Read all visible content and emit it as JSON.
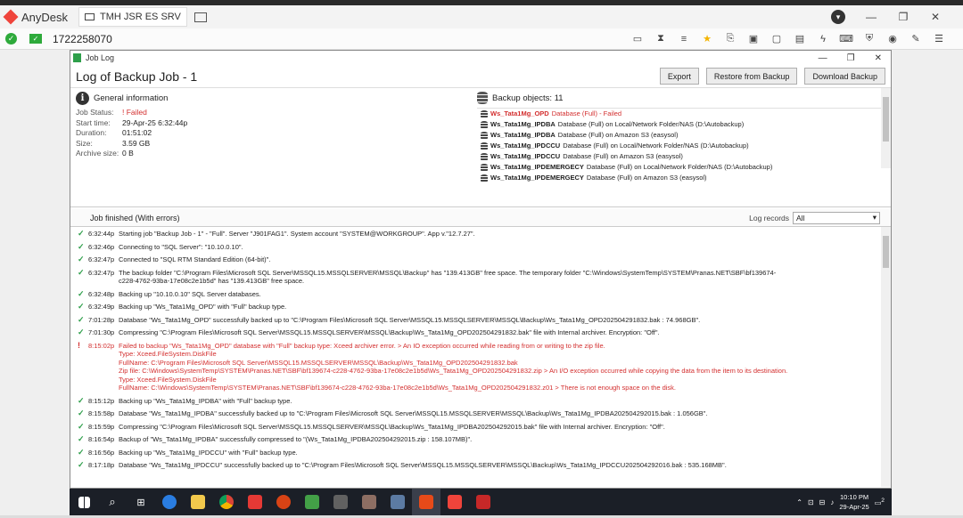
{
  "anydesk": {
    "app_name": "AnyDesk",
    "tab_label": "TMH JSR ES SRV",
    "address_id": "1722258070"
  },
  "window": {
    "title": "Job Log",
    "heading_prefix": "Log of",
    "heading_job": "Backup Job - 1",
    "buttons": {
      "export": "Export",
      "restore": "Restore from Backup",
      "download": "Download Backup"
    }
  },
  "general": {
    "title": "General information",
    "fields": [
      {
        "key": "Job Status:",
        "value": "Failed",
        "status": "error"
      },
      {
        "key": "Start time:",
        "value": "29-Apr-25 6:32:44p"
      },
      {
        "key": "Duration:",
        "value": "01:51:02"
      },
      {
        "key": "Size:",
        "value": "3.59 GB"
      },
      {
        "key": "Archive size:",
        "value": "0 B"
      }
    ]
  },
  "backup_objects": {
    "title": "Backup objects: 11",
    "items": [
      {
        "name": "Ws_Tata1Mg_OPD",
        "detail": "Database (Full) - Failed",
        "error": true
      },
      {
        "name": "Ws_Tata1Mg_IPDBA",
        "detail": "Database (Full) on Local/Network Folder/NAS (D:\\Autobackup)"
      },
      {
        "name": "Ws_Tata1Mg_IPDBA",
        "detail": "Database (Full) on Amazon S3 (easysol)"
      },
      {
        "name": "Ws_Tata1Mg_IPDCCU",
        "detail": "Database (Full) on Local/Network Folder/NAS (D:\\Autobackup)"
      },
      {
        "name": "Ws_Tata1Mg_IPDCCU",
        "detail": "Database (Full) on Amazon S3 (easysol)"
      },
      {
        "name": "Ws_Tata1Mg_IPDEMERGECY",
        "detail": "Database (Full) on Local/Network Folder/NAS (D:\\Autobackup)"
      },
      {
        "name": "Ws_Tata1Mg_IPDEMERGECY",
        "detail": "Database (Full) on Amazon S3 (easysol)"
      }
    ]
  },
  "job_finished": {
    "title": "Job finished (With errors)",
    "log_records_label": "Log records",
    "log_records_value": "All"
  },
  "log": [
    {
      "time": "6:32:44p",
      "status": "ok",
      "lines": [
        "Starting job \"Backup Job - 1\" - \"Full\". Server \"J901FAG1\". System account \"SYSTEM@WORKGROUP\". App v.\"12.7.27\"."
      ]
    },
    {
      "time": "6:32:46p",
      "status": "ok",
      "lines": [
        "Connecting to \"SQL Server\": \"10.10.0.10\"."
      ]
    },
    {
      "time": "6:32:47p",
      "status": "ok",
      "lines": [
        "Connected to \"SQL RTM Standard Edition (64-bit)\"."
      ]
    },
    {
      "time": "6:32:47p",
      "status": "ok",
      "lines": [
        "The backup folder \"C:\\Program Files\\Microsoft SQL Server\\MSSQL15.MSSQLSERVER\\MSSQL\\Backup\" has \"139.413GB\" free space. The temporary folder \"C:\\Windows\\SystemTemp\\SYSTEM\\Pranas.NET\\SBF\\bf139674-",
        "c228-4762-93ba-17e08c2e1b5d\" has \"139.413GB\" free space."
      ]
    },
    {
      "time": "6:32:48p",
      "status": "ok",
      "lines": [
        "Backing up \"10.10.0.10\" SQL Server databases."
      ]
    },
    {
      "time": "6:32:49p",
      "status": "ok",
      "lines": [
        "Backing up \"Ws_Tata1Mg_OPD\" with \"Full\" backup type."
      ]
    },
    {
      "time": "7:01:28p",
      "status": "ok",
      "lines": [
        "Database \"Ws_Tata1Mg_OPD\" successfully backed up to \"C:\\Program Files\\Microsoft SQL Server\\MSSQL15.MSSQLSERVER\\MSSQL\\Backup\\Ws_Tata1Mg_OPD202504291832.bak : 74.968GB\"."
      ]
    },
    {
      "time": "7:01:30p",
      "status": "ok",
      "lines": [
        "Compressing \"C:\\Program Files\\Microsoft SQL Server\\MSSQL15.MSSQLSERVER\\MSSQL\\Backup\\Ws_Tata1Mg_OPD202504291832.bak\" file with Internal archiver. Encryption: \"Off\"."
      ]
    },
    {
      "time": "8:15:02p",
      "status": "error",
      "lines": [
        "Failed to backup \"Ws_Tata1Mg_OPD\" database with \"Full\" backup type: Xceed archiver error. > An IO exception occurred while reading from or writing to the zip file.",
        "Type: Xceed.FileSystem.DiskFile",
        "FullName: C:\\Program Files\\Microsoft SQL Server\\MSSQL15.MSSQLSERVER\\MSSQL\\Backup\\Ws_Tata1Mg_OPD202504291832.bak",
        "Zip file: C:\\Windows\\SystemTemp\\SYSTEM\\Pranas.NET\\SBF\\bf139674-c228-4762-93ba-17e08c2e1b5d\\Ws_Tata1Mg_OPD202504291832.zip > An I/O exception occurred while copying the data from the item to its destination.",
        "Type: Xceed.FileSystem.DiskFile",
        "FullName: C:\\Windows\\SystemTemp\\SYSTEM\\Pranas.NET\\SBF\\bf139674-c228-4762-93ba-17e08c2e1b5d\\Ws_Tata1Mg_OPD202504291832.z01 > There is not enough space on the disk."
      ]
    },
    {
      "time": "8:15:12p",
      "status": "ok",
      "lines": [
        "Backing up \"Ws_Tata1Mg_IPDBA\" with \"Full\" backup type."
      ]
    },
    {
      "time": "8:15:58p",
      "status": "ok",
      "lines": [
        "Database \"Ws_Tata1Mg_IPDBA\" successfully backed up to \"C:\\Program Files\\Microsoft SQL Server\\MSSQL15.MSSQLSERVER\\MSSQL\\Backup\\Ws_Tata1Mg_IPDBA202504292015.bak : 1.056GB\"."
      ]
    },
    {
      "time": "8:15:59p",
      "status": "ok",
      "lines": [
        "Compressing \"C:\\Program Files\\Microsoft SQL Server\\MSSQL15.MSSQLSERVER\\MSSQL\\Backup\\Ws_Tata1Mg_IPDBA202504292015.bak\" file with Internal archiver. Encryption: \"Off\"."
      ]
    },
    {
      "time": "8:16:54p",
      "status": "ok",
      "lines": [
        "Backup of \"Ws_Tata1Mg_IPDBA\" successfully compressed to \"(Ws_Tata1Mg_IPDBA202504292015.zip : 158.107MB)\"."
      ]
    },
    {
      "time": "8:16:56p",
      "status": "ok",
      "lines": [
        "Backing up \"Ws_Tata1Mg_IPDCCU\" with \"Full\" backup type."
      ]
    },
    {
      "time": "8:17:18p",
      "status": "ok",
      "lines": [
        "Database \"Ws_Tata1Mg_IPDCCU\" successfully backed up to \"C:\\Program Files\\Microsoft SQL Server\\MSSQL15.MSSQLSERVER\\MSSQL\\Backup\\Ws_Tata1Mg_IPDCCU202504292016.bak : 535.168MB\"."
      ]
    }
  ],
  "taskbar": {
    "time": "10:10 PM",
    "date": "29-Apr-25",
    "notif_count": "2"
  },
  "colors": {
    "error": "#d32f2f",
    "ok": "#2e9f4a",
    "anydesk_red": "#ef443b"
  }
}
